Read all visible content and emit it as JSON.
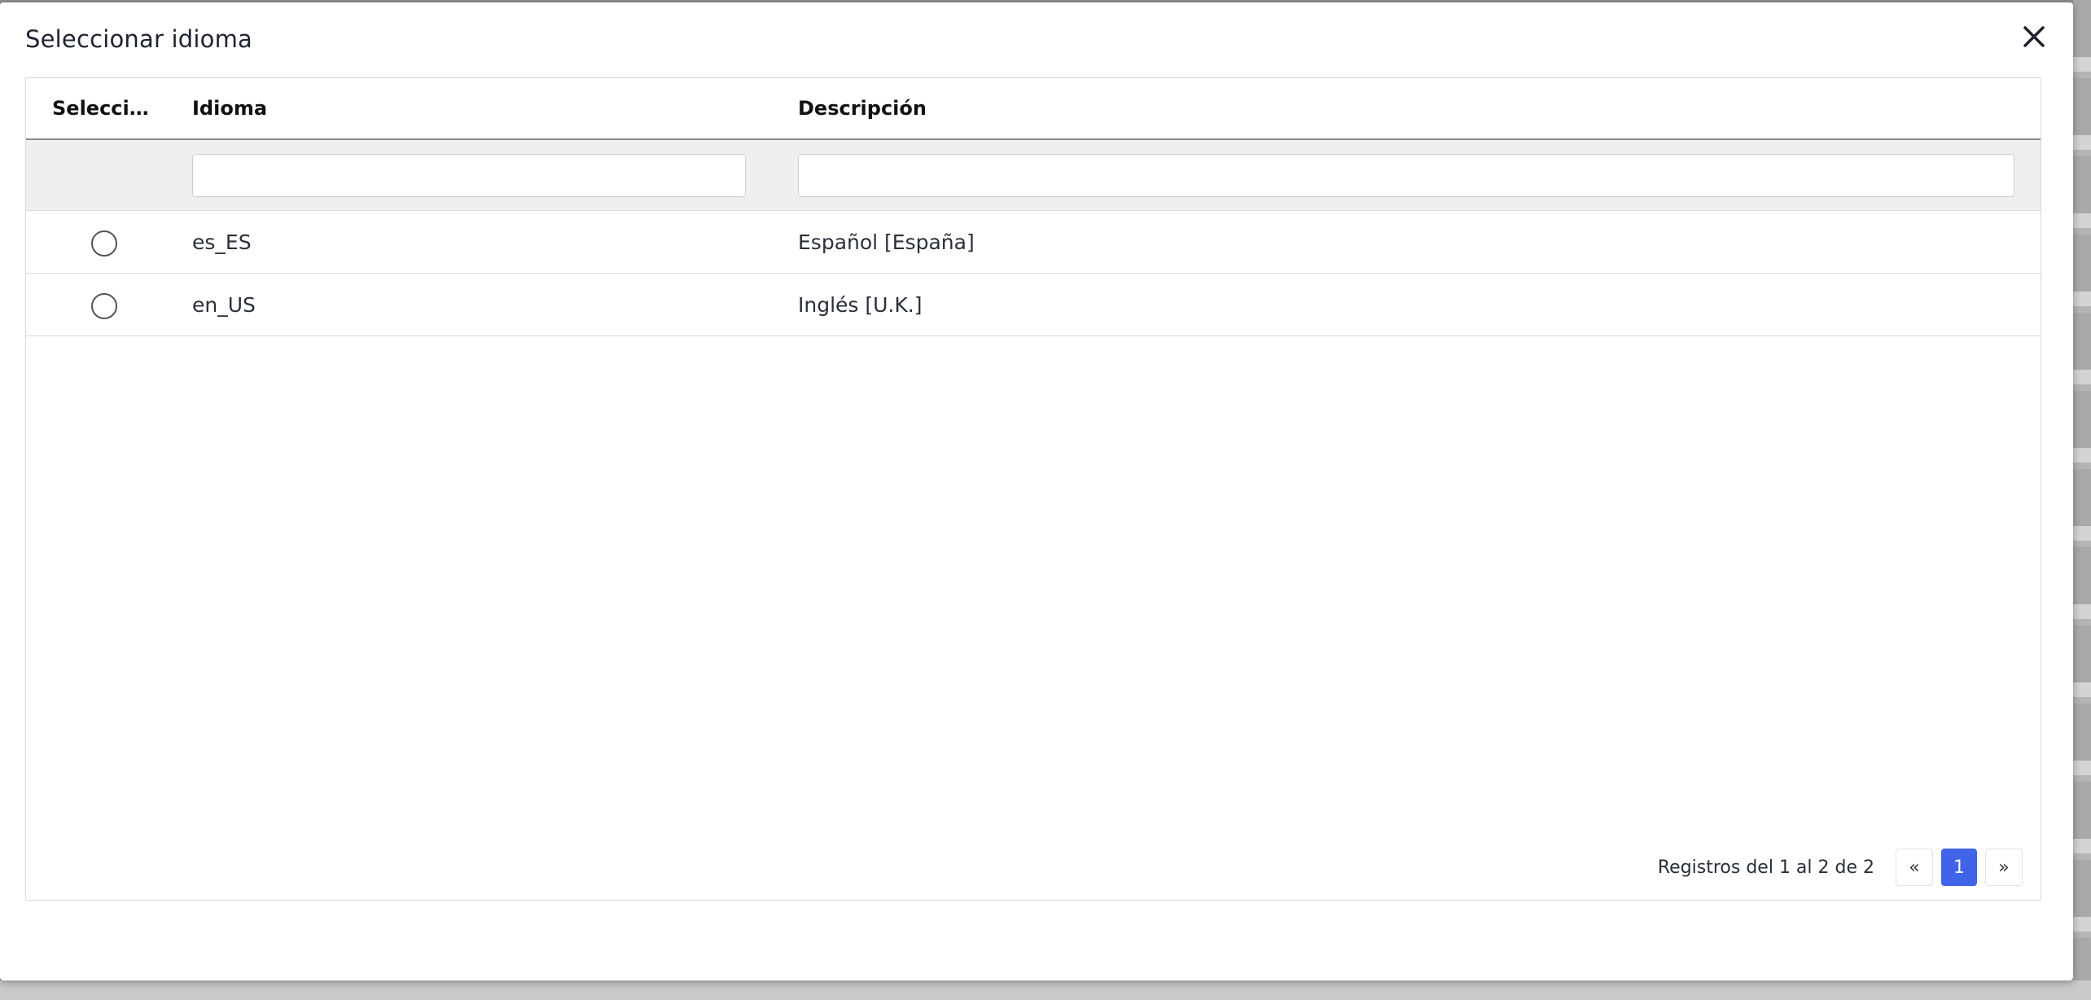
{
  "modal": {
    "title": "Seleccionar idioma"
  },
  "table": {
    "columns": [
      {
        "label": "Selecci..."
      },
      {
        "label": "Idioma"
      },
      {
        "label": "Descripción"
      }
    ],
    "filters": {
      "idioma_value": "",
      "descripcion_value": ""
    },
    "rows": [
      {
        "idioma": "es_ES",
        "descripcion": "Español [España]",
        "selected": false
      },
      {
        "idioma": "en_US",
        "descripcion": "Inglés [U.K.]",
        "selected": false
      }
    ]
  },
  "pagination": {
    "info": "Registros del 1 al 2 de 2",
    "prev_label": "«",
    "current_page": "1",
    "next_label": "»",
    "active_color": "#3f64e8"
  },
  "icons": {
    "close": "close-icon"
  }
}
